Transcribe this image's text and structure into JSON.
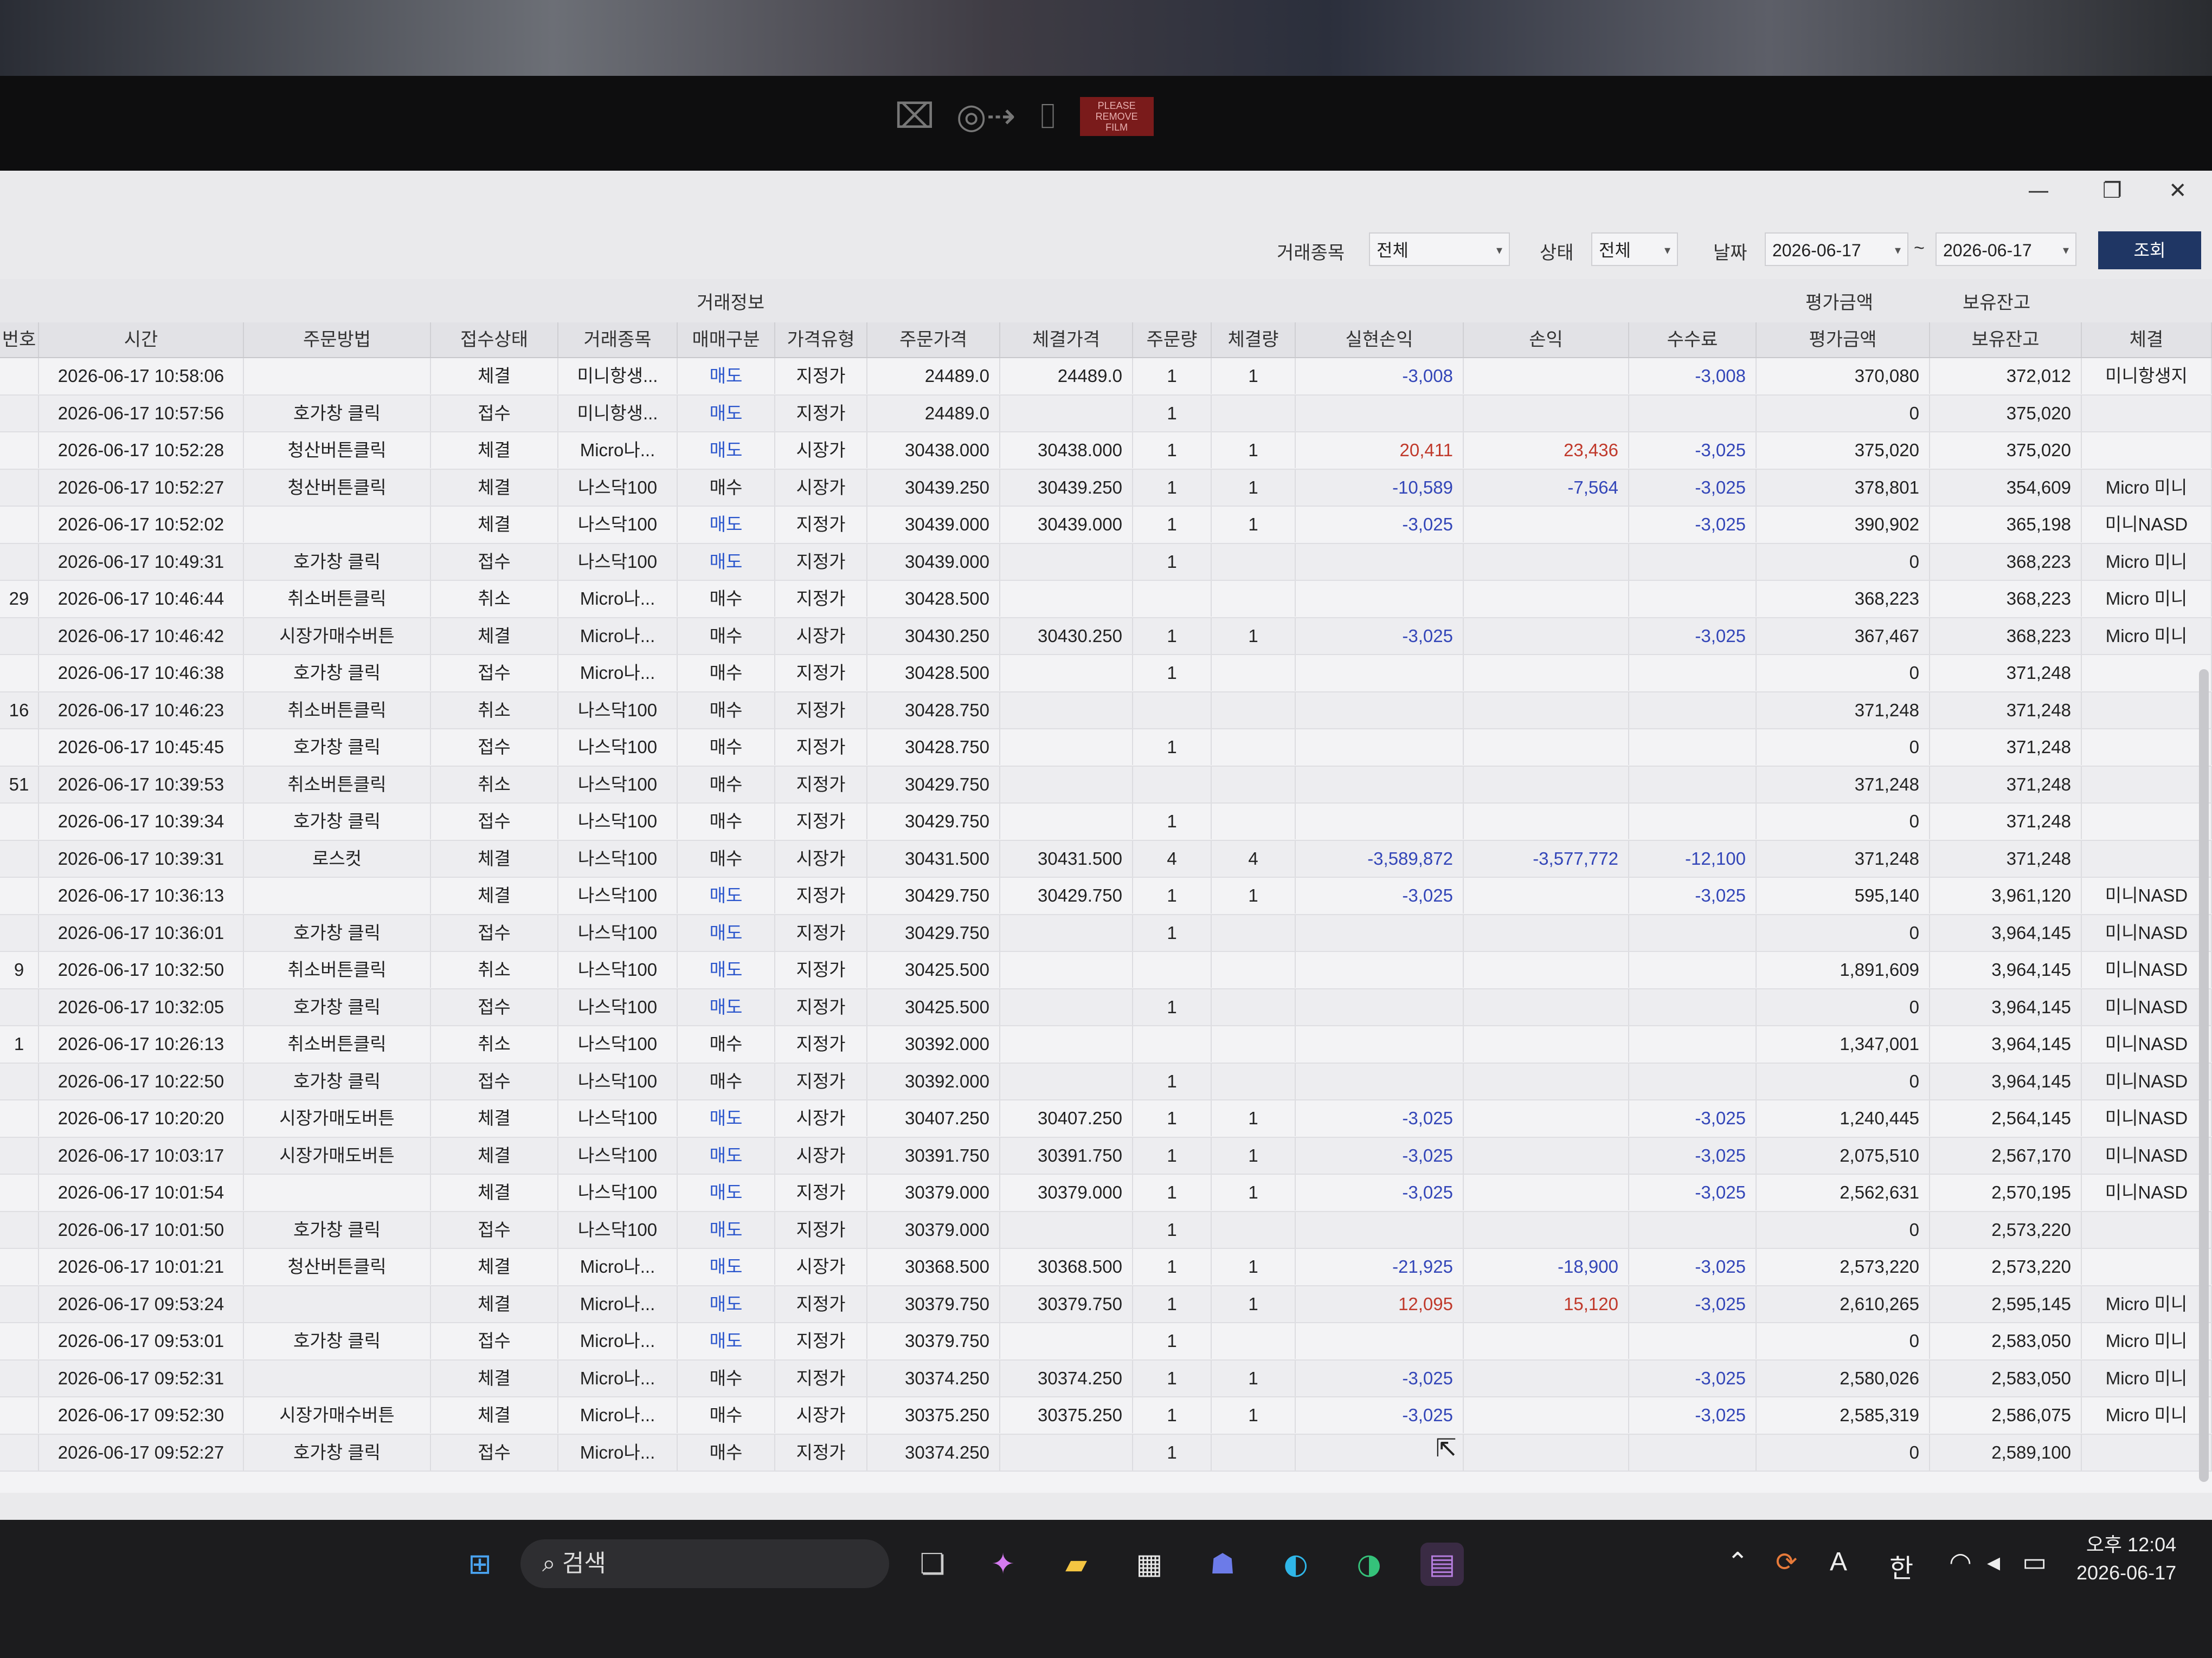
{
  "webcam_overlay": {
    "text": "PLEASE REMOVE FILM"
  },
  "filters": {
    "instrument_label": "거래종목",
    "instrument_value": "전체",
    "status_label": "상태",
    "status_value": "전체",
    "date_label": "날짜",
    "date_from": "2026-06-17",
    "date_sep": "~",
    "date_to": "2026-06-17",
    "search_button": "조회"
  },
  "table": {
    "group_trade_info": "거래정보",
    "group_eval_amount": "평가금액",
    "group_holding_balance": "보유잔고",
    "columns": [
      "번호",
      "시간",
      "주문방법",
      "접수상태",
      "거래종목",
      "매매구분",
      "가격유형",
      "주문가격",
      "체결가격",
      "주문량",
      "체결량",
      "실현손익",
      "손익",
      "수수료",
      "평가금액",
      "보유잔고",
      "체결"
    ],
    "rows": [
      [
        "",
        "2026-06-17 10:58:06",
        "",
        "체결",
        "미니항생...",
        "매도",
        "지정가",
        "24489.0",
        "24489.0",
        "1",
        "1",
        "-3,008",
        "",
        "-3,008",
        "370,080",
        "372,012",
        "미니항생지"
      ],
      [
        "",
        "2026-06-17 10:57:56",
        "호가창 클릭",
        "접수",
        "미니항생...",
        "매도",
        "지정가",
        "24489.0",
        "",
        "1",
        "",
        "",
        "",
        "",
        "0",
        "375,020",
        ""
      ],
      [
        "",
        "2026-06-17 10:52:28",
        "청산버튼클릭",
        "체결",
        "Micro나...",
        "매도",
        "시장가",
        "30438.000",
        "30438.000",
        "1",
        "1",
        "20,411",
        "23,436",
        "-3,025",
        "375,020",
        "375,020",
        ""
      ],
      [
        "",
        "2026-06-17 10:52:27",
        "청산버튼클릭",
        "체결",
        "나스닥100",
        "매수",
        "시장가",
        "30439.250",
        "30439.250",
        "1",
        "1",
        "-10,589",
        "-7,564",
        "-3,025",
        "378,801",
        "354,609",
        "Micro 미니"
      ],
      [
        "",
        "2026-06-17 10:52:02",
        "",
        "체결",
        "나스닥100",
        "매도",
        "지정가",
        "30439.000",
        "30439.000",
        "1",
        "1",
        "-3,025",
        "",
        "-3,025",
        "390,902",
        "365,198",
        "미니NASD"
      ],
      [
        "",
        "2026-06-17 10:49:31",
        "호가창 클릭",
        "접수",
        "나스닥100",
        "매도",
        "지정가",
        "30439.000",
        "",
        "1",
        "",
        "",
        "",
        "",
        "0",
        "368,223",
        "Micro 미니"
      ],
      [
        "29",
        "2026-06-17 10:46:44",
        "취소버튼클릭",
        "취소",
        "Micro나...",
        "매수",
        "지정가",
        "30428.500",
        "",
        "",
        "",
        "",
        "",
        "",
        "368,223",
        "368,223",
        "Micro 미니"
      ],
      [
        "",
        "2026-06-17 10:46:42",
        "시장가매수버튼",
        "체결",
        "Micro나...",
        "매수",
        "시장가",
        "30430.250",
        "30430.250",
        "1",
        "1",
        "-3,025",
        "",
        "-3,025",
        "367,467",
        "368,223",
        "Micro 미니"
      ],
      [
        "",
        "2026-06-17 10:46:38",
        "호가창 클릭",
        "접수",
        "Micro나...",
        "매수",
        "지정가",
        "30428.500",
        "",
        "1",
        "",
        "",
        "",
        "",
        "0",
        "371,248",
        ""
      ],
      [
        "16",
        "2026-06-17 10:46:23",
        "취소버튼클릭",
        "취소",
        "나스닥100",
        "매수",
        "지정가",
        "30428.750",
        "",
        "",
        "",
        "",
        "",
        "",
        "371,248",
        "371,248",
        ""
      ],
      [
        "",
        "2026-06-17 10:45:45",
        "호가창 클릭",
        "접수",
        "나스닥100",
        "매수",
        "지정가",
        "30428.750",
        "",
        "1",
        "",
        "",
        "",
        "",
        "0",
        "371,248",
        ""
      ],
      [
        "51",
        "2026-06-17 10:39:53",
        "취소버튼클릭",
        "취소",
        "나스닥100",
        "매수",
        "지정가",
        "30429.750",
        "",
        "",
        "",
        "",
        "",
        "",
        "371,248",
        "371,248",
        ""
      ],
      [
        "",
        "2026-06-17 10:39:34",
        "호가창 클릭",
        "접수",
        "나스닥100",
        "매수",
        "지정가",
        "30429.750",
        "",
        "1",
        "",
        "",
        "",
        "",
        "0",
        "371,248",
        ""
      ],
      [
        "",
        "2026-06-17 10:39:31",
        "로스컷",
        "체결",
        "나스닥100",
        "매수",
        "시장가",
        "30431.500",
        "30431.500",
        "4",
        "4",
        "-3,589,872",
        "-3,577,772",
        "-12,100",
        "371,248",
        "371,248",
        ""
      ],
      [
        "",
        "2026-06-17 10:36:13",
        "",
        "체결",
        "나스닥100",
        "매도",
        "지정가",
        "30429.750",
        "30429.750",
        "1",
        "1",
        "-3,025",
        "",
        "-3,025",
        "595,140",
        "3,961,120",
        "미니NASD"
      ],
      [
        "",
        "2026-06-17 10:36:01",
        "호가창 클릭",
        "접수",
        "나스닥100",
        "매도",
        "지정가",
        "30429.750",
        "",
        "1",
        "",
        "",
        "",
        "",
        "0",
        "3,964,145",
        "미니NASD"
      ],
      [
        "9",
        "2026-06-17 10:32:50",
        "취소버튼클릭",
        "취소",
        "나스닥100",
        "매도",
        "지정가",
        "30425.500",
        "",
        "",
        "",
        "",
        "",
        "",
        "1,891,609",
        "3,964,145",
        "미니NASD"
      ],
      [
        "",
        "2026-06-17 10:32:05",
        "호가창 클릭",
        "접수",
        "나스닥100",
        "매도",
        "지정가",
        "30425.500",
        "",
        "1",
        "",
        "",
        "",
        "",
        "0",
        "3,964,145",
        "미니NASD"
      ],
      [
        "1",
        "2026-06-17 10:26:13",
        "취소버튼클릭",
        "취소",
        "나스닥100",
        "매수",
        "지정가",
        "30392.000",
        "",
        "",
        "",
        "",
        "",
        "",
        "1,347,001",
        "3,964,145",
        "미니NASD"
      ],
      [
        "",
        "2026-06-17 10:22:50",
        "호가창 클릭",
        "접수",
        "나스닥100",
        "매수",
        "지정가",
        "30392.000",
        "",
        "1",
        "",
        "",
        "",
        "",
        "0",
        "3,964,145",
        "미니NASD"
      ],
      [
        "",
        "2026-06-17 10:20:20",
        "시장가매도버튼",
        "체결",
        "나스닥100",
        "매도",
        "시장가",
        "30407.250",
        "30407.250",
        "1",
        "1",
        "-3,025",
        "",
        "-3,025",
        "1,240,445",
        "2,564,145",
        "미니NASD"
      ],
      [
        "",
        "2026-06-17 10:03:17",
        "시장가매도버튼",
        "체결",
        "나스닥100",
        "매도",
        "시장가",
        "30391.750",
        "30391.750",
        "1",
        "1",
        "-3,025",
        "",
        "-3,025",
        "2,075,510",
        "2,567,170",
        "미니NASD"
      ],
      [
        "",
        "2026-06-17 10:01:54",
        "",
        "체결",
        "나스닥100",
        "매도",
        "지정가",
        "30379.000",
        "30379.000",
        "1",
        "1",
        "-3,025",
        "",
        "-3,025",
        "2,562,631",
        "2,570,195",
        "미니NASD"
      ],
      [
        "",
        "2026-06-17 10:01:50",
        "호가창 클릭",
        "접수",
        "나스닥100",
        "매도",
        "지정가",
        "30379.000",
        "",
        "1",
        "",
        "",
        "",
        "",
        "0",
        "2,573,220",
        ""
      ],
      [
        "",
        "2026-06-17 10:01:21",
        "청산버튼클릭",
        "체결",
        "Micro나...",
        "매도",
        "시장가",
        "30368.500",
        "30368.500",
        "1",
        "1",
        "-21,925",
        "-18,900",
        "-3,025",
        "2,573,220",
        "2,573,220",
        ""
      ],
      [
        "",
        "2026-06-17 09:53:24",
        "",
        "체결",
        "Micro나...",
        "매도",
        "지정가",
        "30379.750",
        "30379.750",
        "1",
        "1",
        "12,095",
        "15,120",
        "-3,025",
        "2,610,265",
        "2,595,145",
        "Micro 미니"
      ],
      [
        "",
        "2026-06-17 09:53:01",
        "호가창 클릭",
        "접수",
        "Micro나...",
        "매도",
        "지정가",
        "30379.750",
        "",
        "1",
        "",
        "",
        "",
        "",
        "0",
        "2,583,050",
        "Micro 미니"
      ],
      [
        "",
        "2026-06-17 09:52:31",
        "",
        "체결",
        "Micro나...",
        "매수",
        "지정가",
        "30374.250",
        "30374.250",
        "1",
        "1",
        "-3,025",
        "",
        "-3,025",
        "2,580,026",
        "2,583,050",
        "Micro 미니"
      ],
      [
        "",
        "2026-06-17 09:52:30",
        "시장가매수버튼",
        "체결",
        "Micro나...",
        "매수",
        "시장가",
        "30375.250",
        "30375.250",
        "1",
        "1",
        "-3,025",
        "",
        "-3,025",
        "2,585,319",
        "2,586,075",
        "Micro 미니"
      ],
      [
        "",
        "2026-06-17 09:52:27",
        "호가창 클릭",
        "접수",
        "Micro나...",
        "매수",
        "지정가",
        "30374.250",
        "",
        "1",
        "",
        "",
        "",
        "",
        "0",
        "2,589,100",
        ""
      ]
    ]
  },
  "taskbar": {
    "search_placeholder": "검색",
    "ime_a": "A",
    "ime_han": "한",
    "clock_ampm_time": "오후 12:04",
    "clock_date": "2026-06-17"
  },
  "colors": {
    "negative": "#3346b8",
    "positive": "#c0392b",
    "sell": "#2a55cc",
    "search_button": "#1f3664"
  }
}
